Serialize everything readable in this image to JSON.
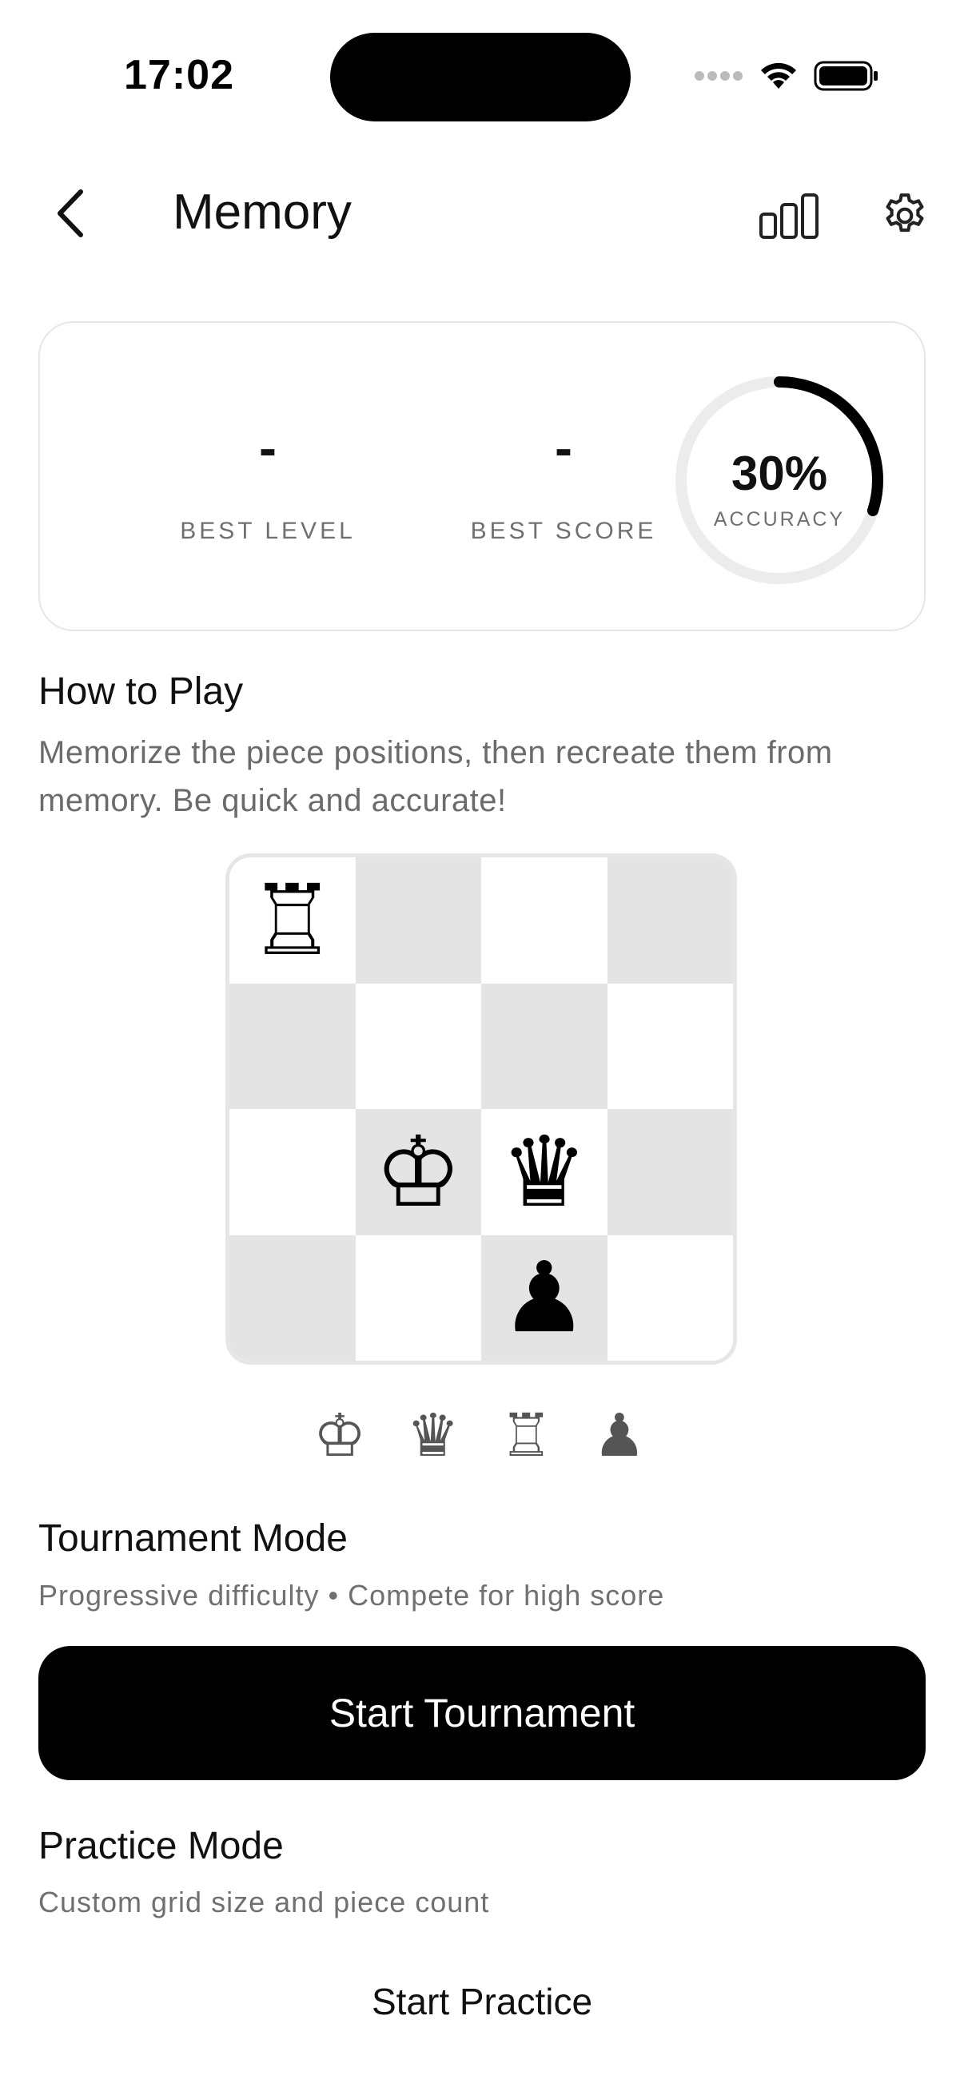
{
  "status_bar": {
    "time": "17:02",
    "icons": [
      "signal-dots-icon",
      "wifi-icon",
      "battery-icon"
    ]
  },
  "header": {
    "title": "Memory",
    "back_icon": "chevron-left-icon",
    "stats_icon": "bar-chart-icon",
    "settings_icon": "gear-icon"
  },
  "stats": {
    "best_level_value": "-",
    "best_level_label": "BEST LEVEL",
    "best_score_value": "-",
    "best_score_label": "BEST SCORE",
    "accuracy_value": "30%",
    "accuracy_label": "ACCURACY",
    "accuracy_fraction": 0.3
  },
  "how_to_play": {
    "title": "How to Play",
    "description": "Memorize the piece positions, then recreate them from memory. Be quick and accurate!"
  },
  "board": {
    "rows": 4,
    "cols": 4,
    "cells": [
      [
        "♖",
        "",
        "",
        ""
      ],
      [
        "",
        "",
        "",
        ""
      ],
      [
        "",
        "♔",
        "♛",
        ""
      ],
      [
        "",
        "",
        "♟",
        ""
      ]
    ]
  },
  "piece_tray": [
    "♔",
    "♛",
    "♖",
    "♟"
  ],
  "tournament": {
    "title": "Tournament Mode",
    "description": "Progressive difficulty • Compete for high score",
    "button_label": "Start Tournament"
  },
  "practice": {
    "title": "Practice Mode",
    "description": "Custom grid size and piece count",
    "button_label": "Start Practice"
  },
  "colors": {
    "accent": "#000000",
    "ring_track": "#ececec",
    "board_dark": "#e4e4e4",
    "muted_text": "#707070"
  }
}
